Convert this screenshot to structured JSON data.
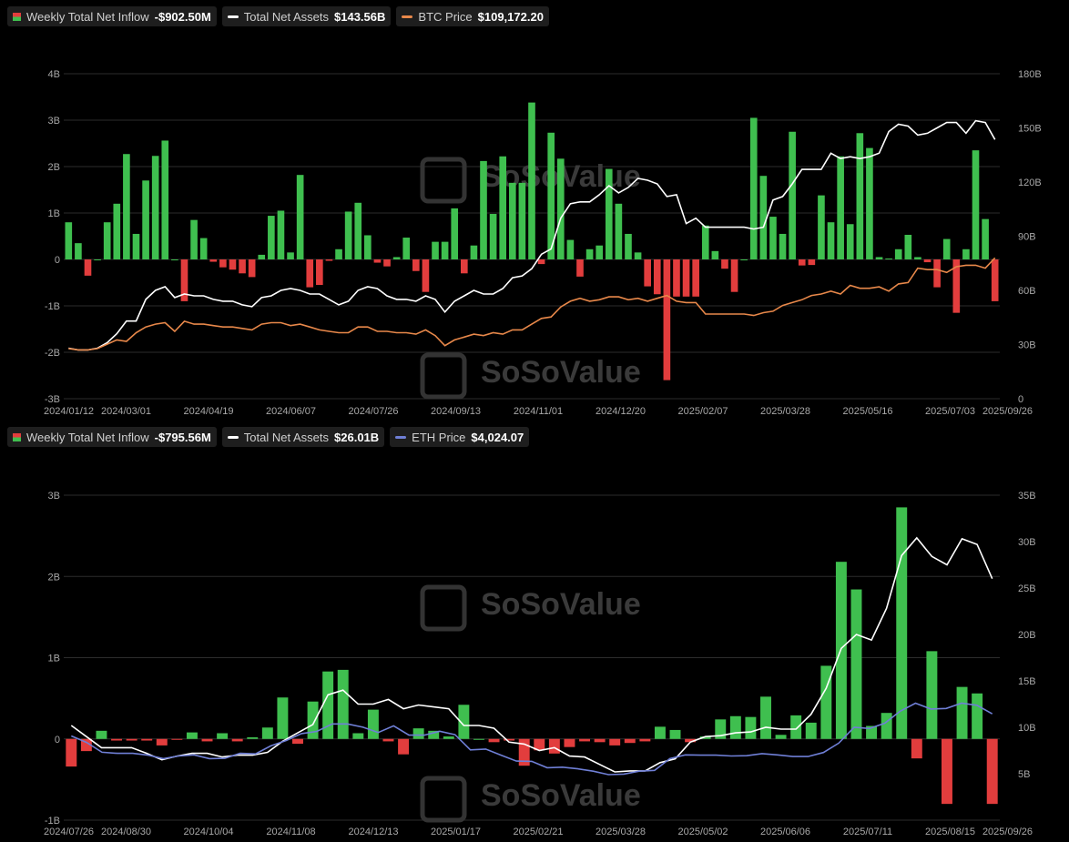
{
  "charts": [
    {
      "legend": [
        {
          "label": "Weekly Total Net Inflow",
          "value": "-$902.50M",
          "swatch": "bar"
        },
        {
          "label": "Total Net Assets",
          "value": "$143.56B",
          "swatch": "line",
          "color": "#ffffff"
        },
        {
          "label": "BTC Price",
          "value": "$109,172.20",
          "swatch": "line",
          "color": "#e8884a"
        }
      ]
    },
    {
      "legend": [
        {
          "label": "Weekly Total Net Inflow",
          "value": "-$795.56M",
          "swatch": "bar"
        },
        {
          "label": "Total Net Assets",
          "value": "$26.01B",
          "swatch": "line",
          "color": "#ffffff"
        },
        {
          "label": "ETH Price",
          "value": "$4,024.07",
          "swatch": "line",
          "color": "#6f7fd6"
        }
      ]
    }
  ],
  "watermark": {
    "brand": "SoSoValue",
    "url": "sosovalue.com"
  },
  "chart_data": [
    {
      "type": "bar",
      "colors": {
        "positive": "#3fbf4f",
        "negative": "#e23d3d",
        "assets_line": "#ffffff",
        "price_line": "#e8884a"
      },
      "ylim_left": [
        -3,
        4
      ],
      "y_ticks_left": [
        "-3B",
        "-2B",
        "-1B",
        "0",
        "1B",
        "2B",
        "3B",
        "4B"
      ],
      "ylim_right": [
        0,
        180
      ],
      "y_ticks_right": [
        "0",
        "30B",
        "60B",
        "90B",
        "120B",
        "150B",
        "180B"
      ],
      "x_ticks": [
        "2024/01/12",
        "2024/03/01",
        "2024/04/19",
        "2024/06/07",
        "2024/07/26",
        "2024/09/13",
        "2024/11/01",
        "2024/12/20",
        "2025/02/07",
        "2025/03/28",
        "2025/05/16",
        "2025/07/03",
        "2025/09/26"
      ],
      "series": [
        {
          "name": "Weekly Total Net Inflow",
          "unit": "B USD",
          "values": [
            0.8,
            0.35,
            -0.35,
            0,
            0.8,
            1.2,
            2.27,
            0.55,
            1.7,
            2.23,
            2.56,
            0,
            -0.9,
            0.85,
            0.46,
            -0.05,
            -0.17,
            -0.22,
            -0.3,
            -0.38,
            0.1,
            0.94,
            1.05,
            0.15,
            1.82,
            -0.6,
            -0.55,
            -0.03,
            0.22,
            1.03,
            1.22,
            0.52,
            -0.07,
            -0.15,
            0.05,
            0.47,
            -0.25,
            -0.7,
            0.38,
            0.38,
            1.1,
            -0.3,
            0.3,
            2.12,
            0.98,
            2.22,
            1.65,
            1.65,
            3.38,
            -0.1,
            2.73,
            2.17,
            0.42,
            -0.37,
            0.22,
            0.3,
            1.95,
            1.2,
            0.55,
            0.15,
            -0.58,
            -0.75,
            -2.6,
            -0.8,
            -0.8,
            -0.8,
            0.73,
            0.18,
            -0.2,
            -0.7,
            0,
            3.05,
            1.8,
            0.92,
            0.55,
            2.75,
            -0.13,
            -0.12,
            1.38,
            0.8,
            2.22,
            0.76,
            2.72,
            2.4,
            0.05,
            0.02,
            0.22,
            0.53,
            0.05,
            -0.06,
            -0.6,
            0.44,
            -1.15,
            0.22,
            2.35,
            0.87,
            -0.9
          ]
        },
        {
          "name": "Total Net Assets",
          "unit": "B USD",
          "values": [
            28,
            27,
            27,
            28,
            31,
            36,
            43,
            43,
            55,
            60,
            62,
            56,
            58,
            57,
            57,
            55,
            54,
            54,
            52,
            51,
            56,
            57,
            60,
            61,
            60,
            58,
            58,
            55,
            52,
            54,
            60,
            62,
            61,
            57,
            55,
            55,
            54,
            57,
            55,
            48,
            54,
            57,
            60,
            58,
            58,
            61,
            67,
            68,
            72,
            80,
            83,
            100,
            108,
            109,
            109,
            113,
            118,
            114,
            117,
            122,
            121,
            119,
            112,
            113,
            97,
            100,
            95,
            95,
            95,
            95,
            95,
            94,
            95,
            110,
            112,
            119,
            127,
            127,
            127,
            136,
            133,
            134,
            133,
            134,
            136,
            148,
            152,
            151,
            146,
            147,
            150,
            153,
            153,
            147,
            154,
            153,
            143.56
          ]
        },
        {
          "name": "BTC Price",
          "unit": "K USD",
          "values": [
            46,
            45,
            45,
            46,
            49,
            52,
            51,
            57,
            61,
            63,
            64,
            58,
            65,
            63,
            63,
            62,
            61,
            61,
            60,
            59,
            63,
            64,
            64,
            62,
            63,
            61,
            59,
            58,
            57,
            57,
            61,
            61,
            58,
            58,
            57,
            57,
            56,
            59,
            55,
            48,
            52,
            54,
            56,
            55,
            57,
            56,
            59,
            59,
            63,
            67,
            68,
            75,
            79,
            81,
            79,
            80,
            82,
            82,
            80,
            81,
            79,
            81,
            83,
            79,
            78,
            78,
            70,
            70,
            70,
            70,
            70,
            69,
            71,
            72,
            76,
            78,
            80,
            83,
            84,
            86,
            84,
            90,
            88,
            88,
            89,
            86,
            91,
            92,
            102,
            101,
            101,
            99,
            103,
            104,
            104,
            102,
            109.17
          ]
        }
      ]
    },
    {
      "type": "bar",
      "colors": {
        "positive": "#3fbf4f",
        "negative": "#e23d3d",
        "assets_line": "#ffffff",
        "price_line": "#6f7fd6"
      },
      "ylim_left": [
        -1,
        3
      ],
      "y_ticks_left": [
        "-1B",
        "0",
        "1B",
        "2B",
        "3B"
      ],
      "ylim_right": [
        0,
        35
      ],
      "y_ticks_right": [
        "5B",
        "10B",
        "15B",
        "20B",
        "25B",
        "30B",
        "35B"
      ],
      "x_ticks": [
        "2024/07/26",
        "2024/08/30",
        "2024/10/04",
        "2024/11/08",
        "2024/12/13",
        "2025/01/17",
        "2025/02/21",
        "2025/03/28",
        "2025/05/02",
        "2025/06/06",
        "2025/07/11",
        "2025/08/15",
        "2025/09/26"
      ],
      "series": [
        {
          "name": "Weekly Total Net Inflow",
          "unit": "B USD",
          "values": [
            -0.34,
            -0.15,
            0.1,
            -0.02,
            -0.02,
            -0.02,
            -0.08,
            -0.01,
            0.08,
            -0.03,
            0.07,
            -0.03,
            0.02,
            0.14,
            0.51,
            -0.06,
            0.46,
            0.83,
            0.85,
            0.07,
            0.36,
            -0.03,
            -0.19,
            0.13,
            0.1,
            0.03,
            0.42,
            0,
            -0.04,
            -0.02,
            -0.33,
            -0.14,
            -0.18,
            -0.1,
            -0.03,
            -0.04,
            -0.08,
            -0.05,
            -0.03,
            0.15,
            0.11,
            -0.04,
            0.03,
            0.24,
            0.28,
            0.27,
            0.52,
            0.05,
            0.29,
            0.2,
            0.9,
            2.18,
            1.84,
            0.16,
            0.32,
            2.85,
            -0.24,
            1.08,
            -0.8,
            0.64,
            0.56,
            -0.8
          ]
        },
        {
          "name": "Total Net Assets",
          "unit": "B USD",
          "values": [
            10.2,
            9,
            7.8,
            7.8,
            7.8,
            7.2,
            6.5,
            6.9,
            7.2,
            7.2,
            6.8,
            7,
            7,
            7.3,
            8.5,
            9.4,
            10.3,
            13.5,
            14,
            12.5,
            12.5,
            13,
            12,
            12.4,
            12.2,
            12,
            10.2,
            10.2,
            9.9,
            8.4,
            8.2,
            7.5,
            7.8,
            6.9,
            6.8,
            6,
            5.2,
            5.3,
            5.3,
            6.2,
            6.6,
            8.4,
            9,
            9.1,
            9.4,
            9.5,
            10,
            9.8,
            9.8,
            11.4,
            14.2,
            18.5,
            20,
            19.4,
            22.8,
            28.5,
            30.4,
            28.4,
            27.5,
            30.3,
            29.7,
            26.01
          ]
        },
        {
          "name": "ETH Price",
          "unit": "K USD",
          "values": [
            3.27,
            3.03,
            2.66,
            2.62,
            2.62,
            2.55,
            2.42,
            2.52,
            2.56,
            2.42,
            2.43,
            2.62,
            2.6,
            2.9,
            3.1,
            3.36,
            3.44,
            3.72,
            3.72,
            3.6,
            3.4,
            3.65,
            3.3,
            3.3,
            3.45,
            3.32,
            2.75,
            2.78,
            2.55,
            2.33,
            2.32,
            2.08,
            2.1,
            2.04,
            1.95,
            1.82,
            1.84,
            1.95,
            1.98,
            2.42,
            2.56,
            2.55,
            2.55,
            2.52,
            2.53,
            2.61,
            2.56,
            2.5,
            2.5,
            2.65,
            3,
            3.6,
            3.55,
            3.75,
            4.2,
            4.5,
            4.28,
            4.3,
            4.5,
            4.42,
            4.1
          ]
        }
      ]
    }
  ]
}
